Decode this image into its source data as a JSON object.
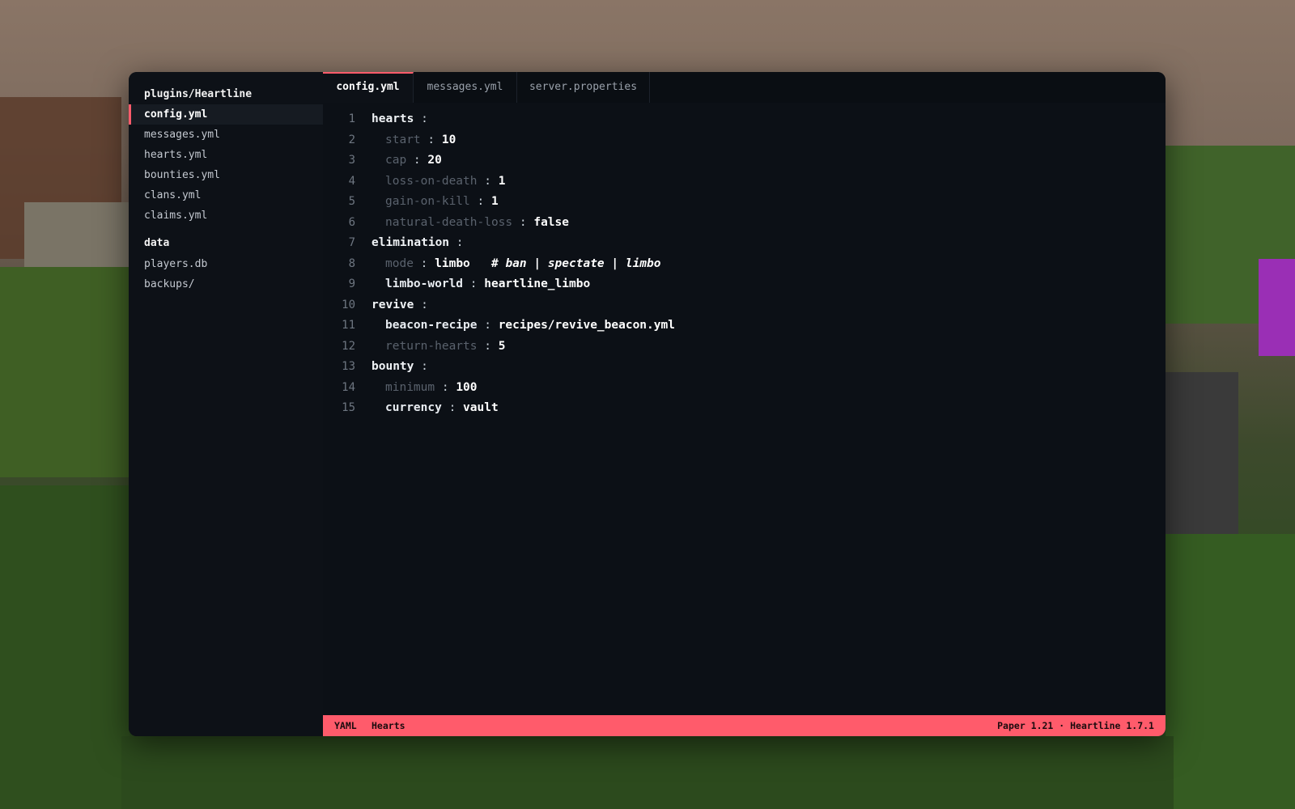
{
  "sidebar": {
    "sections": [
      {
        "title": "plugins/Heartline",
        "items": [
          "config.yml",
          "messages.yml",
          "hearts.yml",
          "bounties.yml",
          "clans.yml",
          "claims.yml"
        ]
      },
      {
        "title": "data",
        "items": [
          "players.db",
          "backups/"
        ]
      }
    ],
    "active_item": "config.yml"
  },
  "tabs": [
    {
      "label": "config.yml",
      "active": true
    },
    {
      "label": "messages.yml",
      "active": false
    },
    {
      "label": "server.properties",
      "active": false
    }
  ],
  "code": [
    {
      "n": "1",
      "key": "hearts",
      "indent": false,
      "dim": false,
      "colon": " :",
      "value": "",
      "comment": ""
    },
    {
      "n": "2",
      "key": "start",
      "indent": true,
      "dim": true,
      "colon": " : ",
      "value": "10",
      "comment": ""
    },
    {
      "n": "3",
      "key": "cap",
      "indent": true,
      "dim": true,
      "colon": " : ",
      "value": "20",
      "comment": ""
    },
    {
      "n": "4",
      "key": "loss-on-death",
      "indent": true,
      "dim": true,
      "colon": " : ",
      "value": "1",
      "comment": ""
    },
    {
      "n": "5",
      "key": "gain-on-kill",
      "indent": true,
      "dim": true,
      "colon": " : ",
      "value": "1",
      "comment": ""
    },
    {
      "n": "6",
      "key": "natural-death-loss",
      "indent": true,
      "dim": true,
      "colon": " : ",
      "value": "false",
      "comment": ""
    },
    {
      "n": "7",
      "key": "elimination",
      "indent": false,
      "dim": false,
      "colon": " :",
      "value": "",
      "comment": ""
    },
    {
      "n": "8",
      "key": "mode",
      "indent": true,
      "dim": true,
      "colon": " : ",
      "value": "limbo",
      "comment": "# ban | spectate | limbo"
    },
    {
      "n": "9",
      "key": "limbo-world",
      "indent": true,
      "dim": false,
      "colon": " : ",
      "value": "heartline_limbo",
      "comment": ""
    },
    {
      "n": "10",
      "key": "revive",
      "indent": false,
      "dim": false,
      "colon": " :",
      "value": "",
      "comment": ""
    },
    {
      "n": "11",
      "key": "beacon-recipe",
      "indent": true,
      "dim": false,
      "colon": " : ",
      "value": "recipes/revive_beacon.yml",
      "comment": ""
    },
    {
      "n": "12",
      "key": "return-hearts",
      "indent": true,
      "dim": true,
      "colon": " : ",
      "value": "5",
      "comment": ""
    },
    {
      "n": "13",
      "key": "bounty",
      "indent": false,
      "dim": false,
      "colon": " :",
      "value": "",
      "comment": ""
    },
    {
      "n": "14",
      "key": "minimum",
      "indent": true,
      "dim": true,
      "colon": " : ",
      "value": "100",
      "comment": ""
    },
    {
      "n": "15",
      "key": "currency",
      "indent": true,
      "dim": false,
      "colon": " : ",
      "value": "vault",
      "comment": ""
    }
  ],
  "status": {
    "language": "YAML",
    "mode": "Hearts",
    "version": "Paper 1.21 · Heartline 1.7.1"
  },
  "colors": {
    "accent": "#ff5b6b",
    "editor_bg": "#0d1117"
  }
}
